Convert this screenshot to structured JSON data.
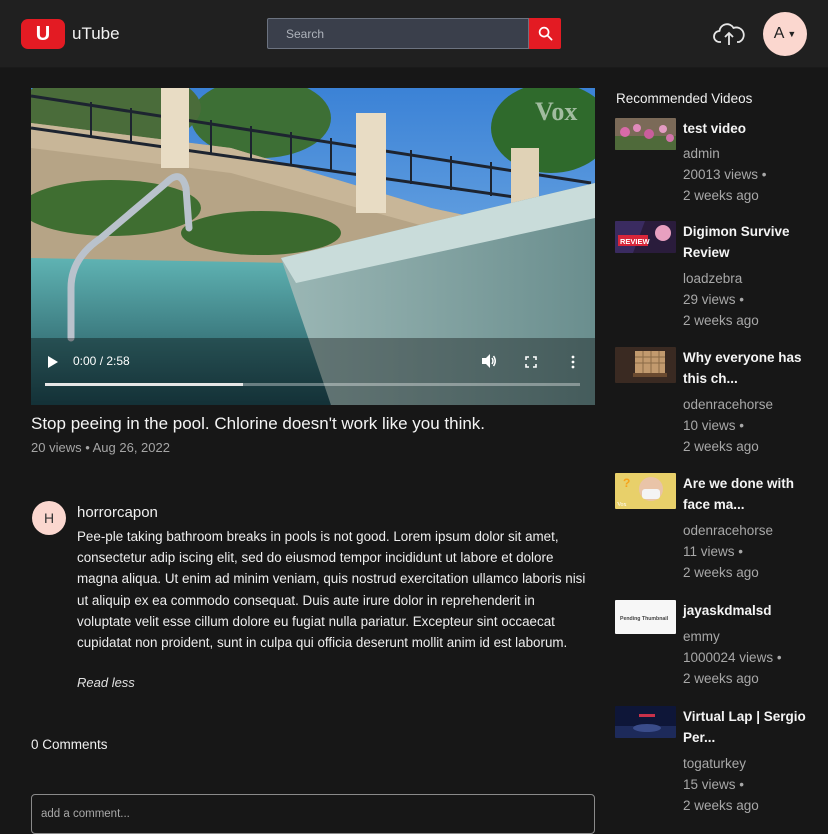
{
  "header": {
    "logo_letter": "U",
    "app_name": "uTube",
    "search_placeholder": "Search",
    "search_icon": "search-icon",
    "upload_icon": "cloud-upload-icon",
    "avatar_letter": "A",
    "brand_color": "#e31b23"
  },
  "player": {
    "time": "0:00 / 2:58",
    "progress": 0.37,
    "watermark": "Vox"
  },
  "video": {
    "title": "Stop peeing in the pool. Chlorine doesn't work like you think.",
    "meta": "20 views • Aug 26, 2022"
  },
  "description": {
    "avatar_letter": "H",
    "author": "horrorcapon",
    "text": "Pee-ple taking bathroom breaks in pools is not good. Lorem ipsum dolor sit amet, consectetur adip iscing elit, sed do eiusmod tempor incididunt ut labore et dolore magna aliqua. Ut enim ad minim veniam, quis nostrud exercitation ullamco laboris nisi ut aliquip ex ea commodo consequat. Duis aute irure dolor in reprehenderit in voluptate velit esse cillum dolore eu fugiat nulla pariatur. Excepteur sint occaecat cupidatat non proident, sunt in culpa qui officia deserunt mollit anim id est laborum.",
    "read_less": "Read less"
  },
  "comments": {
    "count_label": "0 Comments",
    "input_placeholder": "add a comment..."
  },
  "recommended": {
    "heading": "Recommended Videos",
    "items": [
      {
        "title": "test video",
        "channel": "admin",
        "views": "20013 views •",
        "age": "2 weeks ago"
      },
      {
        "title": "Digimon Survive Review",
        "channel": "loadzebra",
        "views": "29 views •",
        "age": "2 weeks ago",
        "thumb_text": "REVIEW"
      },
      {
        "title": "Why everyone has this ch...",
        "channel": "odenracehorse",
        "views": "10 views •",
        "age": "2 weeks ago"
      },
      {
        "title": "Are we done with face ma...",
        "channel": "odenracehorse",
        "views": "11 views •",
        "age": "2 weeks ago",
        "thumb_text": "Vox"
      },
      {
        "title": "jayaskdmalsd",
        "channel": "emmy",
        "views": "1000024 views •",
        "age": "2 weeks ago",
        "thumb_text": "Pending Thumbnail"
      },
      {
        "title": "Virtual Lap | Sergio Per...",
        "channel": "togaturkey",
        "views": "15 views •",
        "age": "2 weeks ago"
      }
    ]
  }
}
